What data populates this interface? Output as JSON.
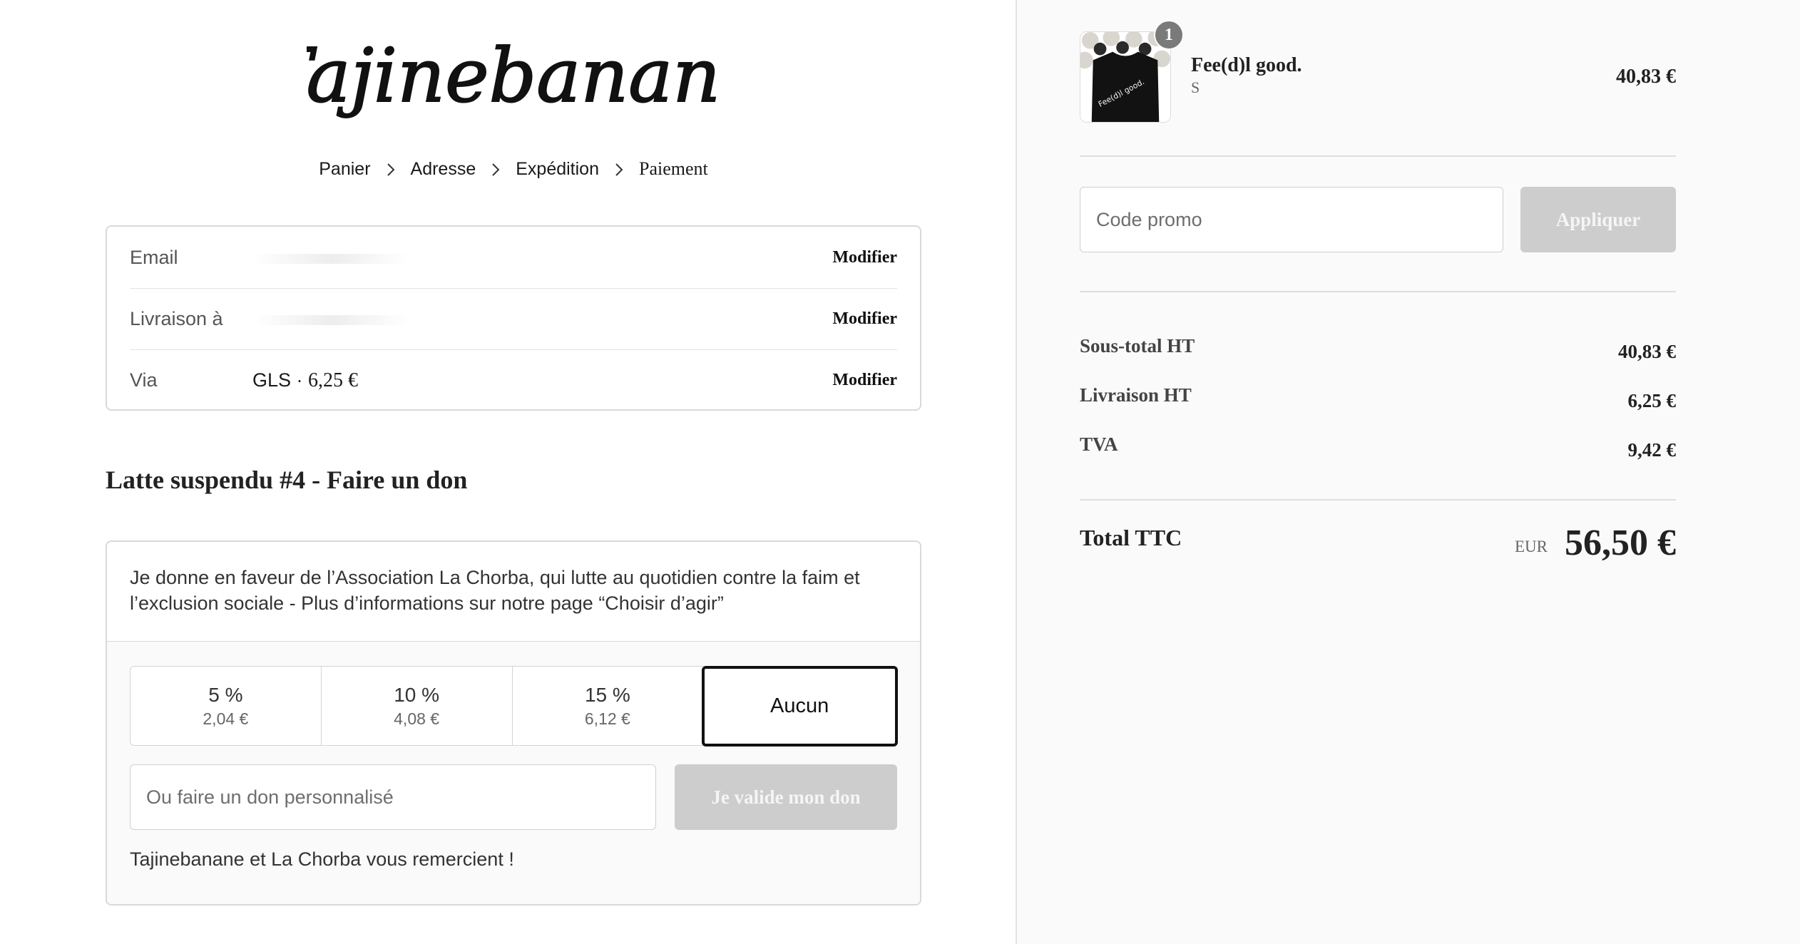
{
  "brand": {
    "name": "Tajinebanane"
  },
  "breadcrumb": {
    "steps": [
      "Panier",
      "Adresse",
      "Expédition",
      "Paiement"
    ]
  },
  "contact": {
    "rows": [
      {
        "label": "Email",
        "value": "",
        "action": "Modifier"
      },
      {
        "label": "Livraison à",
        "value": "",
        "action": "Modifier"
      },
      {
        "label": "Via",
        "value_sans": "GLS · ",
        "value_price": "6,25 €",
        "action": "Modifier"
      }
    ]
  },
  "donation": {
    "title": "Latte suspendu #4 - Faire un don",
    "description": "Je donne en faveur de l’Association La Chorba, qui lutte au quotidien contre la faim et l’exclusion sociale - Plus d’informations sur notre page “Choisir d’agir”",
    "options": [
      {
        "pct": "5 %",
        "amount": "2,04 €"
      },
      {
        "pct": "10 %",
        "amount": "4,08 €"
      },
      {
        "pct": "15 %",
        "amount": "6,12 €"
      },
      {
        "pct": "Aucun",
        "selected": true
      }
    ],
    "custom_placeholder": "Ou faire un don personnalisé",
    "submit_label": "Je valide mon don",
    "thanks": "Tajinebanane et La Chorba vous remercient !"
  },
  "cart": {
    "item": {
      "name": "Fee(d)l good.",
      "variant": "S",
      "price": "40,83 €",
      "quantity": "1",
      "thumb_text": "Fee(d)l good."
    },
    "promo": {
      "placeholder": "Code promo",
      "apply_label": "Appliquer"
    },
    "lines": [
      {
        "label": "Sous-total HT",
        "value": "40,83 €"
      },
      {
        "label": "Livraison HT",
        "value": "6,25 €"
      },
      {
        "label": "TVA",
        "value": "9,42 €"
      }
    ],
    "total": {
      "label": "Total TTC",
      "currency": "EUR",
      "amount": "56,50 €"
    }
  },
  "colors": {
    "disabled_button": "#cdcdcd",
    "sidebar_bg": "#fafafa",
    "border": "#d9d9d9"
  }
}
